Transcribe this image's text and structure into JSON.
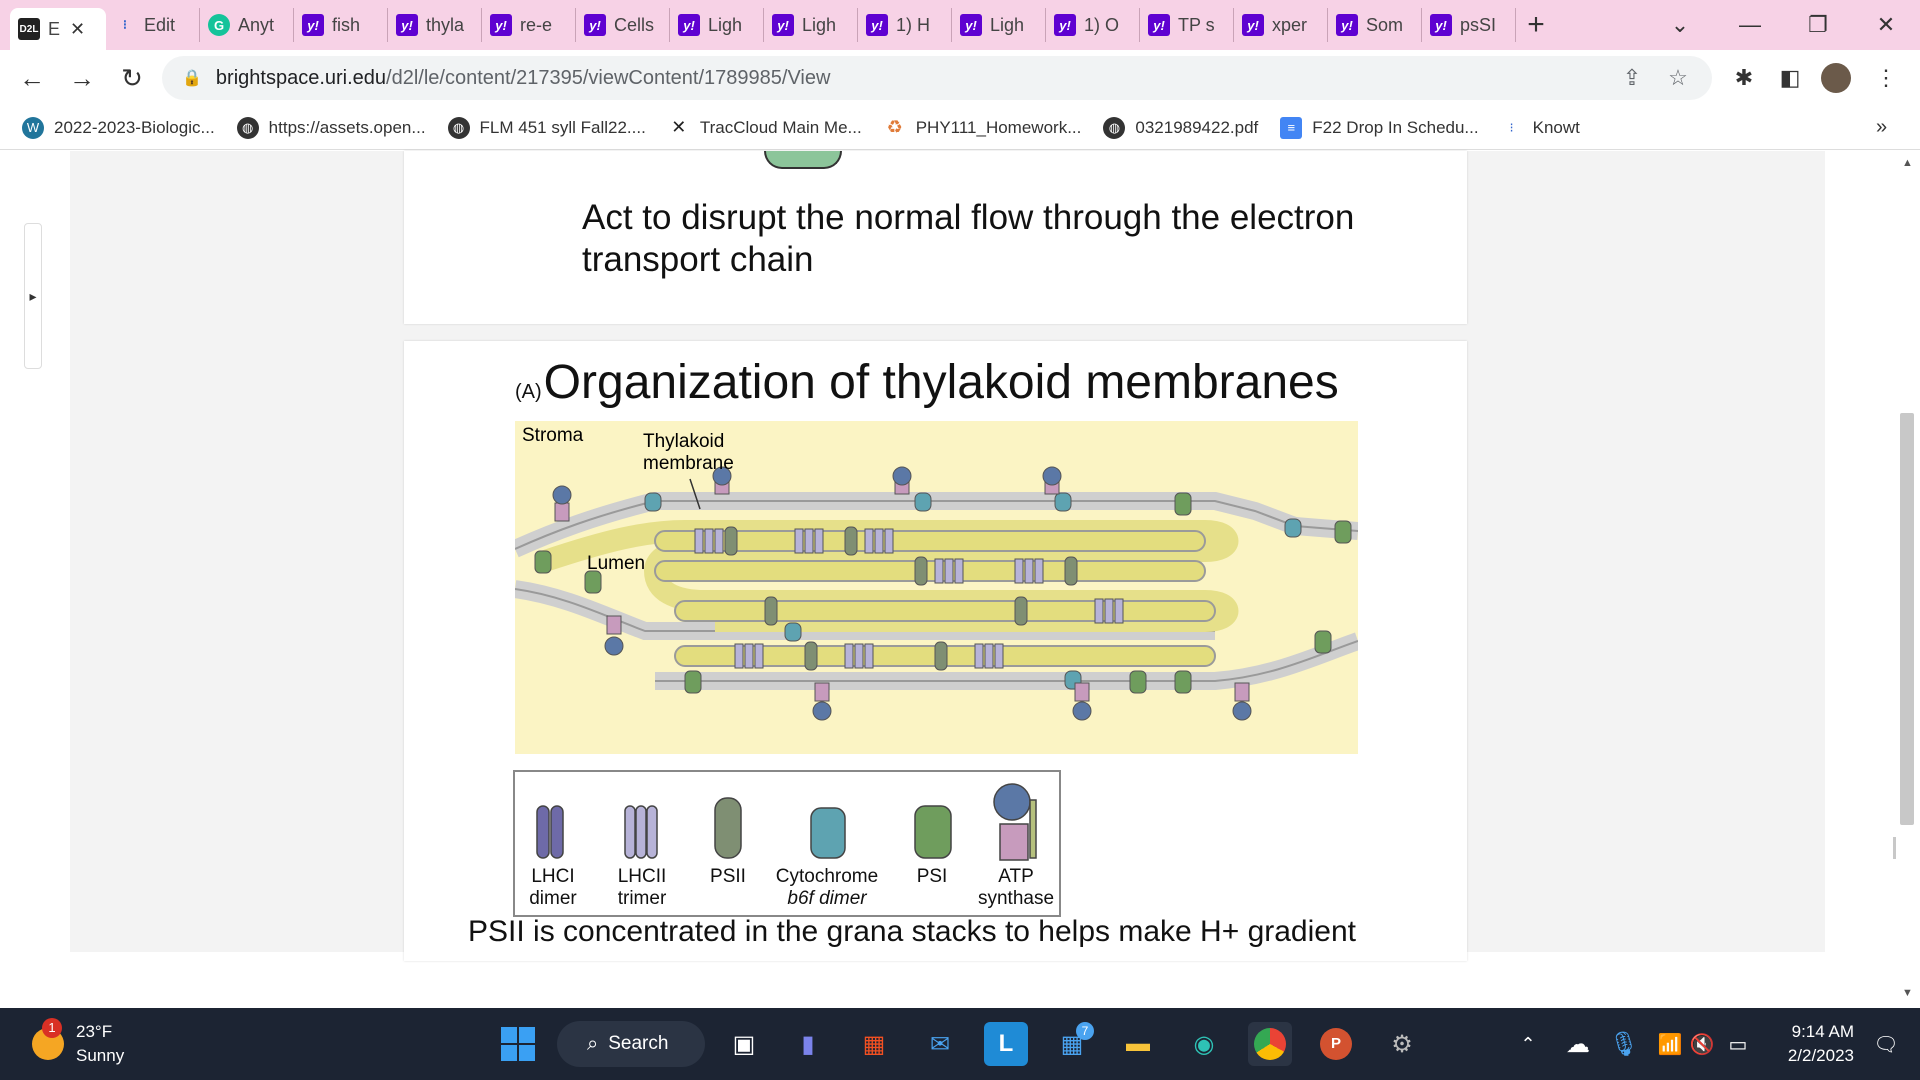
{
  "browser": {
    "tabs": [
      {
        "label": "E",
        "favicon": "D2L",
        "active": true
      },
      {
        "label": "Edit",
        "favicon": "knowt-icon"
      },
      {
        "label": "Anyt",
        "favicon": "G"
      },
      {
        "label": "fish",
        "favicon": "y!"
      },
      {
        "label": "thyla",
        "favicon": "y!"
      },
      {
        "label": "re-e",
        "favicon": "y!"
      },
      {
        "label": "Cells",
        "favicon": "y!"
      },
      {
        "label": "Ligh",
        "favicon": "y!"
      },
      {
        "label": "Ligh",
        "favicon": "y!"
      },
      {
        "label": "1) H",
        "favicon": "y!"
      },
      {
        "label": "Ligh",
        "favicon": "y!"
      },
      {
        "label": "1) O",
        "favicon": "y!"
      },
      {
        "label": "TP s",
        "favicon": "y!"
      },
      {
        "label": "xper",
        "favicon": "y!"
      },
      {
        "label": "Som",
        "favicon": "y!"
      },
      {
        "label": "psSI",
        "favicon": "y!"
      }
    ],
    "url_host": "brightspace.uri.edu",
    "url_path": "/d2l/le/content/217395/viewContent/1789985/View",
    "bookmarks": [
      {
        "label": "2022-2023-Biologic...",
        "icon": "wordpress-icon"
      },
      {
        "label": "https://assets.open...",
        "icon": "globe-icon"
      },
      {
        "label": "FLM 451 syll Fall22....",
        "icon": "globe-icon"
      },
      {
        "label": "TracCloud Main Me...",
        "icon": "traccloud-icon"
      },
      {
        "label": "PHY111_Homework...",
        "icon": "recycle-icon"
      },
      {
        "label": "0321989422.pdf",
        "icon": "globe-icon"
      },
      {
        "label": "F22 Drop In Schedu...",
        "icon": "docs-icon"
      },
      {
        "label": "Knowt",
        "icon": "knowt-icon"
      }
    ],
    "more_bookmarks": "»"
  },
  "slide1": {
    "text_line1": "Act to disrupt the normal flow through the electron",
    "text_line2": "transport chain"
  },
  "slide2": {
    "panel_label": "(A)",
    "title": "Organization of thylakoid membranes",
    "label_stroma": "Stroma",
    "label_thylakoid1": "Thylakoid",
    "label_thylakoid2": "membrane",
    "label_lumen": "Lumen",
    "legend": [
      {
        "line1": "LHCI",
        "line2": "dimer",
        "color": "#6e6aa8"
      },
      {
        "line1": "LHCII",
        "line2": "trimer",
        "color": "#b7b3d8"
      },
      {
        "line1": "PSII",
        "line2": "",
        "color": "#7f8f73"
      },
      {
        "line1": "Cytochrome",
        "line2": "b6f dimer",
        "color": "#5ea3b1"
      },
      {
        "line1": "PSI",
        "line2": "",
        "color": "#6f9d5d"
      },
      {
        "line1": "ATP",
        "line2": "synthase",
        "color": "#c79bbd"
      }
    ],
    "caption": "PSII is concentrated in the grana stacks to helps make H+ gradient"
  },
  "taskbar": {
    "weather_temp": "23°F",
    "weather_desc": "Sunny",
    "weather_badge": "1",
    "search_label": "Search",
    "teams_badge": "7",
    "time": "9:14 AM",
    "date": "2/2/2023"
  }
}
